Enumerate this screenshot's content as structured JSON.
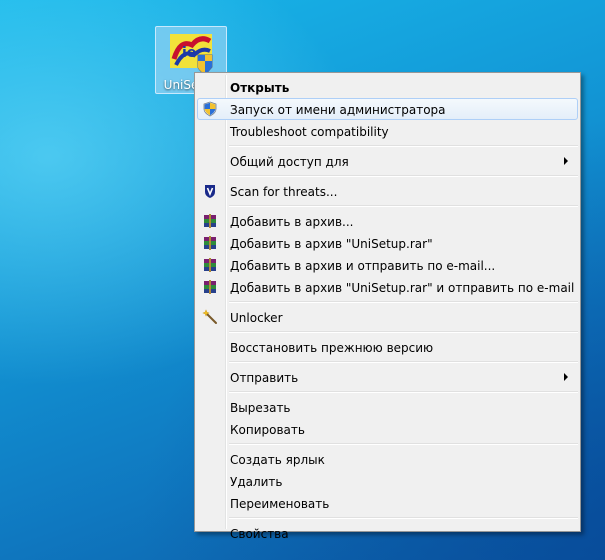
{
  "desktop": {
    "icon_label": "UniSetup"
  },
  "context_menu": {
    "open": "Открыть",
    "run_as_admin": "Запуск от имени администратора",
    "troubleshoot": "Troubleshoot compatibility",
    "share_with": "Общий доступ для",
    "scan_threats": "Scan for threats...",
    "add_archive": "Добавить в архив...",
    "add_archive_named": "Добавить в архив \"UniSetup.rar\"",
    "add_archive_email": "Добавить в архив и отправить по e-mail...",
    "add_archive_named_email": "Добавить в архив \"UniSetup.rar\" и отправить по e-mail",
    "unlocker": "Unlocker",
    "restore_version": "Восстановить прежнюю версию",
    "send_to": "Отправить",
    "cut": "Вырезать",
    "copy": "Копировать",
    "create_shortcut": "Создать ярлык",
    "delete": "Удалить",
    "rename": "Переименовать",
    "properties": "Свойства"
  }
}
